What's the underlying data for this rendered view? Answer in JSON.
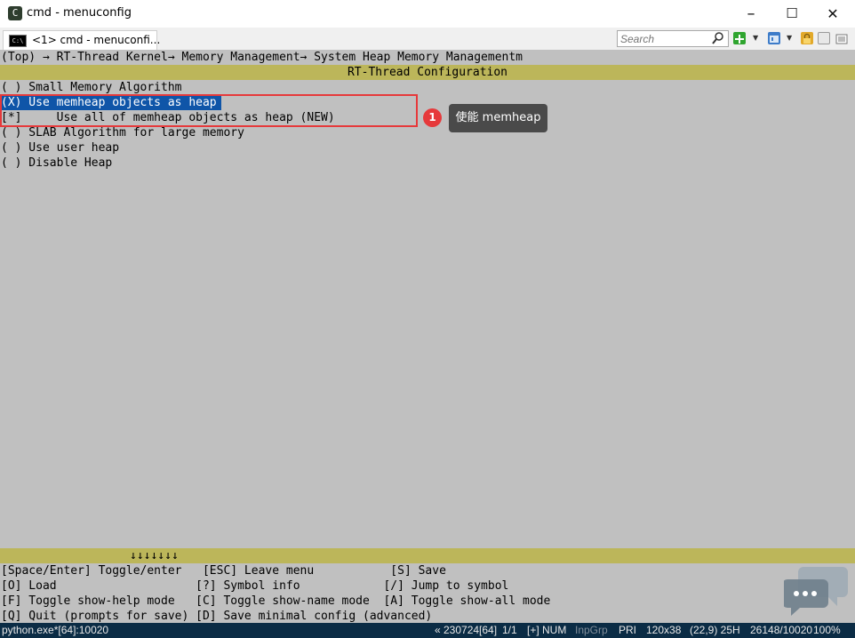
{
  "window": {
    "title": "cmd - menuconfig",
    "icon_glyph": "C",
    "controls": {
      "minimize": "–",
      "maximize": "☐",
      "close": "✕"
    }
  },
  "toolbar": {
    "tab_label": "<1> cmd - menuconfi...",
    "tab_icon_text": "C:\\",
    "search_placeholder": "Search",
    "icons": [
      "search-icon",
      "new-console-icon",
      "view-icon",
      "lock-icon",
      "panel-icon",
      "menu-icon"
    ]
  },
  "terminal": {
    "breadcrumb": "(Top) → RT-Thread Kernel→ Memory Management→ System Heap Memory Managementm",
    "config_title": "RT-Thread Configuration",
    "menu_items": [
      "( ) Small Memory Algorithm",
      "(X) Use memheap objects as heap",
      "[*]     Use all of memheap objects as heap (NEW)",
      "( ) SLAB Algorithm for large memory",
      "( ) Use user heap",
      "( ) Disable Heap"
    ],
    "scroll_arrows": "↓↓↓↓↓↓↓",
    "help_lines": [
      "[Space/Enter] Toggle/enter   [ESC] Leave menu           [S] Save",
      "[O] Load                    [?] Symbol info            [/] Jump to symbol",
      "[F] Toggle show-help mode   [C] Toggle show-name mode  [A] Toggle show-all mode",
      "[Q] Quit (prompts for save) [D] Save minimal config (advanced)"
    ]
  },
  "annotation": {
    "number": "1",
    "label": "使能 memheap",
    "color": "#e6393b"
  },
  "statusbar": {
    "process": "python.exe*[64]:10020",
    "build": "« 230724[64]",
    "page": "1/1",
    "insert": "[+] NUM",
    "inpgrp": "InpGrp",
    "pri": "PRI",
    "size": "120x38",
    "cursor": "(22,9) 25H",
    "pid": "26148/10020",
    "zoom": "100%"
  },
  "colors": {
    "terminal_bg": "#c0c0c0",
    "title_bar_bg": "#bcb65a",
    "selection_bg": "#0f55a8",
    "statusbar_bg": "#0b2c45"
  }
}
